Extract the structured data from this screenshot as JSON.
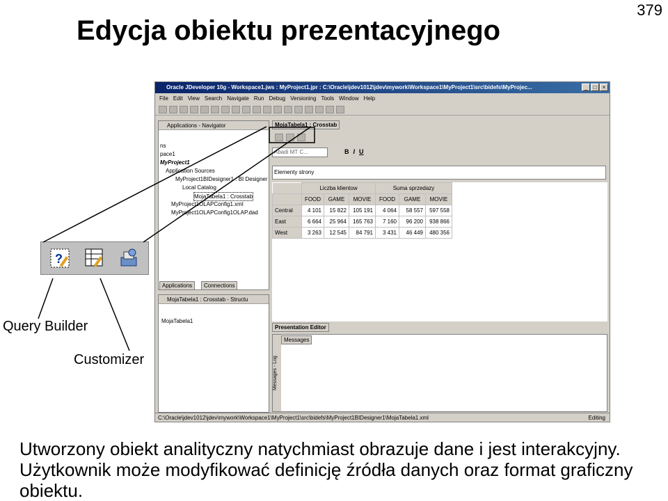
{
  "slide": {
    "title": "Edycja obiektu prezentacyjnego",
    "page_number": "379",
    "caption_line1": "Utworzony obiekt analityczny natychmiast obrazuje dane i jest interakcyjny.",
    "caption_line2": "Użytkownik może modyfikować definicję źródła danych oraz format graficzny",
    "caption_line3": "obiektu.",
    "callout_query_builder": "Query Builder",
    "callout_customizer": "Customizer"
  },
  "ide": {
    "window_title": "Oracle JDeveloper 10g - Workspace1.jws : MyProject1.jpr : C:\\Oracle\\jdev1012\\jdev\\mywork\\Workspace1\\MyProject1\\src\\bidefs\\MyProjec...",
    "menu": [
      "File",
      "Edit",
      "View",
      "Search",
      "Navigate",
      "Run",
      "Debug",
      "Versioning",
      "Tools",
      "Window",
      "Help"
    ],
    "navigator_title": "Applications - Navigator",
    "editor_tab": "MojaTabela1 : Crosstab",
    "font_combo": "Abadi MT C...",
    "element_label": "Elementy strony",
    "tree": [
      "ns",
      "pace1",
      "MyProject1",
      "Application Sources",
      "MyProject1BIDesigner1 : BI Designer",
      "Local Catalog",
      "MojaTabela1 : Crosstab",
      "MyProject1OLAPConfig1.xml",
      "MyProject1OLAPConfig1OLAP.dad"
    ],
    "nav_tab_apps": "Applications",
    "nav_tab_conn": "Connections",
    "structure_title": "MojaTabela1 : Crosstab - Structu",
    "structure_item": "MojaTabela1",
    "presentation_tab": "Presentation Editor",
    "messages_tab": "Messages",
    "messages_log": "Messages - Log",
    "status_path": "C:\\Oracle\\jdev1012\\jdev\\mywork\\Workspace1\\MyProject1\\src\\bidefs\\MyProject1BIDesigner1\\MojaTabela1.xml",
    "status_mode": "Editing"
  },
  "crosstab": {
    "measures": [
      "Liczba klientow",
      "Suma sprzedazy"
    ],
    "columns": [
      "FOOD",
      "GAME",
      "MOVIE",
      "FOOD",
      "GAME",
      "MOVIE"
    ],
    "rows": [
      {
        "label": "Central",
        "values": [
          "4 101",
          "15 822",
          "105 191",
          "4 064",
          "58 557",
          "597 558"
        ]
      },
      {
        "label": "East",
        "values": [
          "6 664",
          "25 964",
          "165 763",
          "7 160",
          "96 200",
          "938 866"
        ]
      },
      {
        "label": "West",
        "values": [
          "3 263",
          "12 545",
          "84 791",
          "3 431",
          "46 449",
          "480 356"
        ]
      }
    ]
  },
  "icons": {
    "zoom": [
      "query-builder-icon",
      "customizer-icon",
      "data-source-icon"
    ]
  }
}
